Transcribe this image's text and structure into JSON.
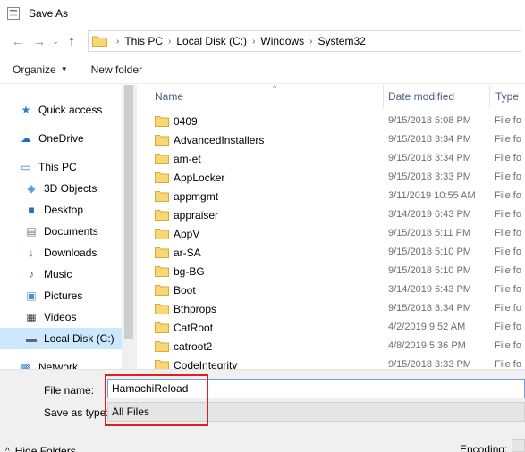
{
  "window": {
    "title": "Save As"
  },
  "nav": {
    "back_glyph": "←",
    "forward_glyph": "→",
    "recent_glyph": "⌄",
    "up_glyph": "↑",
    "breadcrumbs": [
      "This PC",
      "Local Disk (C:)",
      "Windows",
      "System32"
    ],
    "sep_glyph": "›"
  },
  "toolbar": {
    "organize_label": "Organize",
    "caret_glyph": "▼",
    "new_folder_label": "New folder"
  },
  "navpane": {
    "items": [
      {
        "label": "Quick access",
        "icon": "star-icon",
        "glyph": "★"
      },
      {
        "label": "OneDrive",
        "icon": "cloud-icon",
        "glyph": "☁"
      },
      {
        "label": "This PC",
        "icon": "computer-icon",
        "glyph": "▭"
      },
      {
        "label": "3D Objects",
        "icon": "cube-icon",
        "glyph": "◆"
      },
      {
        "label": "Desktop",
        "icon": "desktop-icon",
        "glyph": "■"
      },
      {
        "label": "Documents",
        "icon": "document-icon",
        "glyph": "▤"
      },
      {
        "label": "Downloads",
        "icon": "download-icon",
        "glyph": "↓"
      },
      {
        "label": "Music",
        "icon": "music-icon",
        "glyph": "♪"
      },
      {
        "label": "Pictures",
        "icon": "picture-icon",
        "glyph": "▣"
      },
      {
        "label": "Videos",
        "icon": "video-icon",
        "glyph": "▦"
      },
      {
        "label": "Local Disk (C:)",
        "icon": "drive-icon",
        "glyph": "▬"
      },
      {
        "label": "Network",
        "icon": "network-icon",
        "glyph": "▩"
      }
    ]
  },
  "files": {
    "columns": {
      "name": "Name",
      "date": "Date modified",
      "type": "Type"
    },
    "sort_glyph": "^",
    "rows": [
      {
        "name": "0409",
        "date": "9/15/2018 5:08 PM",
        "type": "File fo"
      },
      {
        "name": "AdvancedInstallers",
        "date": "9/15/2018 3:34 PM",
        "type": "File fo"
      },
      {
        "name": "am-et",
        "date": "9/15/2018 3:34 PM",
        "type": "File fo"
      },
      {
        "name": "AppLocker",
        "date": "9/15/2018 3:33 PM",
        "type": "File fo"
      },
      {
        "name": "appmgmt",
        "date": "3/11/2019 10:55 AM",
        "type": "File fo"
      },
      {
        "name": "appraiser",
        "date": "3/14/2019 6:43 PM",
        "type": "File fo"
      },
      {
        "name": "AppV",
        "date": "9/15/2018 5:11 PM",
        "type": "File fo"
      },
      {
        "name": "ar-SA",
        "date": "9/15/2018 5:10 PM",
        "type": "File fo"
      },
      {
        "name": "bg-BG",
        "date": "9/15/2018 5:10 PM",
        "type": "File fo"
      },
      {
        "name": "Boot",
        "date": "3/14/2019 6:43 PM",
        "type": "File fo"
      },
      {
        "name": "Bthprops",
        "date": "9/15/2018 3:34 PM",
        "type": "File fo"
      },
      {
        "name": "CatRoot",
        "date": "4/2/2019 9:52 AM",
        "type": "File fo"
      },
      {
        "name": "catroot2",
        "date": "4/8/2019 5:36 PM",
        "type": "File fo"
      },
      {
        "name": "CodeIntegrity",
        "date": "9/15/2018 3:33 PM",
        "type": "File fo"
      }
    ]
  },
  "form": {
    "file_name_label": "File name:",
    "file_name_value": "HamachiReload",
    "save_type_label": "Save as type:",
    "save_type_value": "All Files",
    "hide_folders_label": "Hide Folders",
    "hide_folders_glyph": "^",
    "encoding_label": "Encoding:"
  },
  "colors": {
    "accent": "#0078d7",
    "highlight": "#e0201f",
    "folder": "#f8d775",
    "selected": "#cce8ff"
  }
}
